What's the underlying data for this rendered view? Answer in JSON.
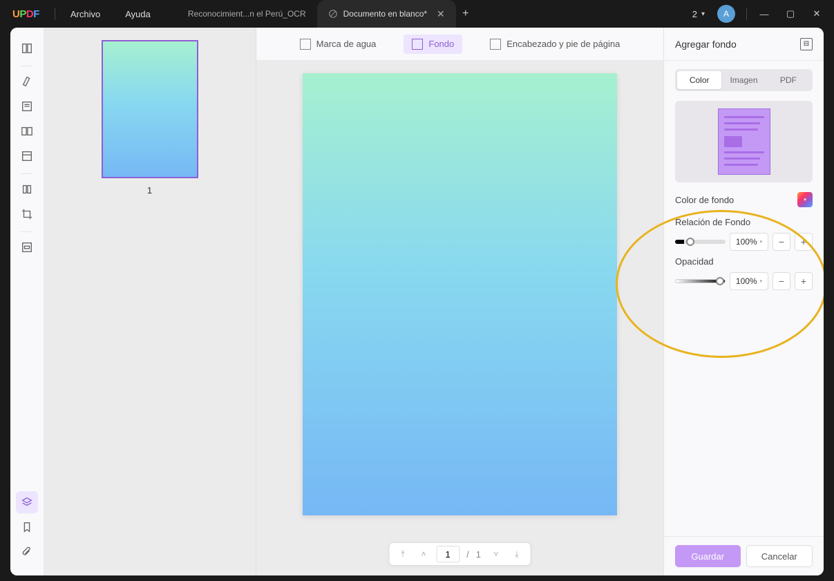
{
  "logo": {
    "u": "U",
    "p": "P",
    "d": "D",
    "f": "F"
  },
  "menu": {
    "archivo": "Archivo",
    "ayuda": "Ayuda"
  },
  "tabs": {
    "inactive": "Reconocimient...n el Perú_OCR",
    "active": "Documento en blanco*"
  },
  "titlebar": {
    "num": "2",
    "avatar": "A"
  },
  "topopts": {
    "watermark": "Marca de agua",
    "background": "Fondo",
    "headerfooter": "Encabezado y pie de página"
  },
  "thumb": {
    "num": "1"
  },
  "pager": {
    "current": "1",
    "total": "1"
  },
  "right": {
    "title": "Agregar fondo",
    "seg": {
      "color": "Color",
      "image": "Imagen",
      "pdf": "PDF"
    },
    "bgcolor_label": "Color de fondo",
    "ratio_label": "Relación de Fondo",
    "opacity_label": "Opacidad",
    "ratio_value": "100%",
    "opacity_value": "100%",
    "save": "Guardar",
    "cancel": "Cancelar"
  }
}
